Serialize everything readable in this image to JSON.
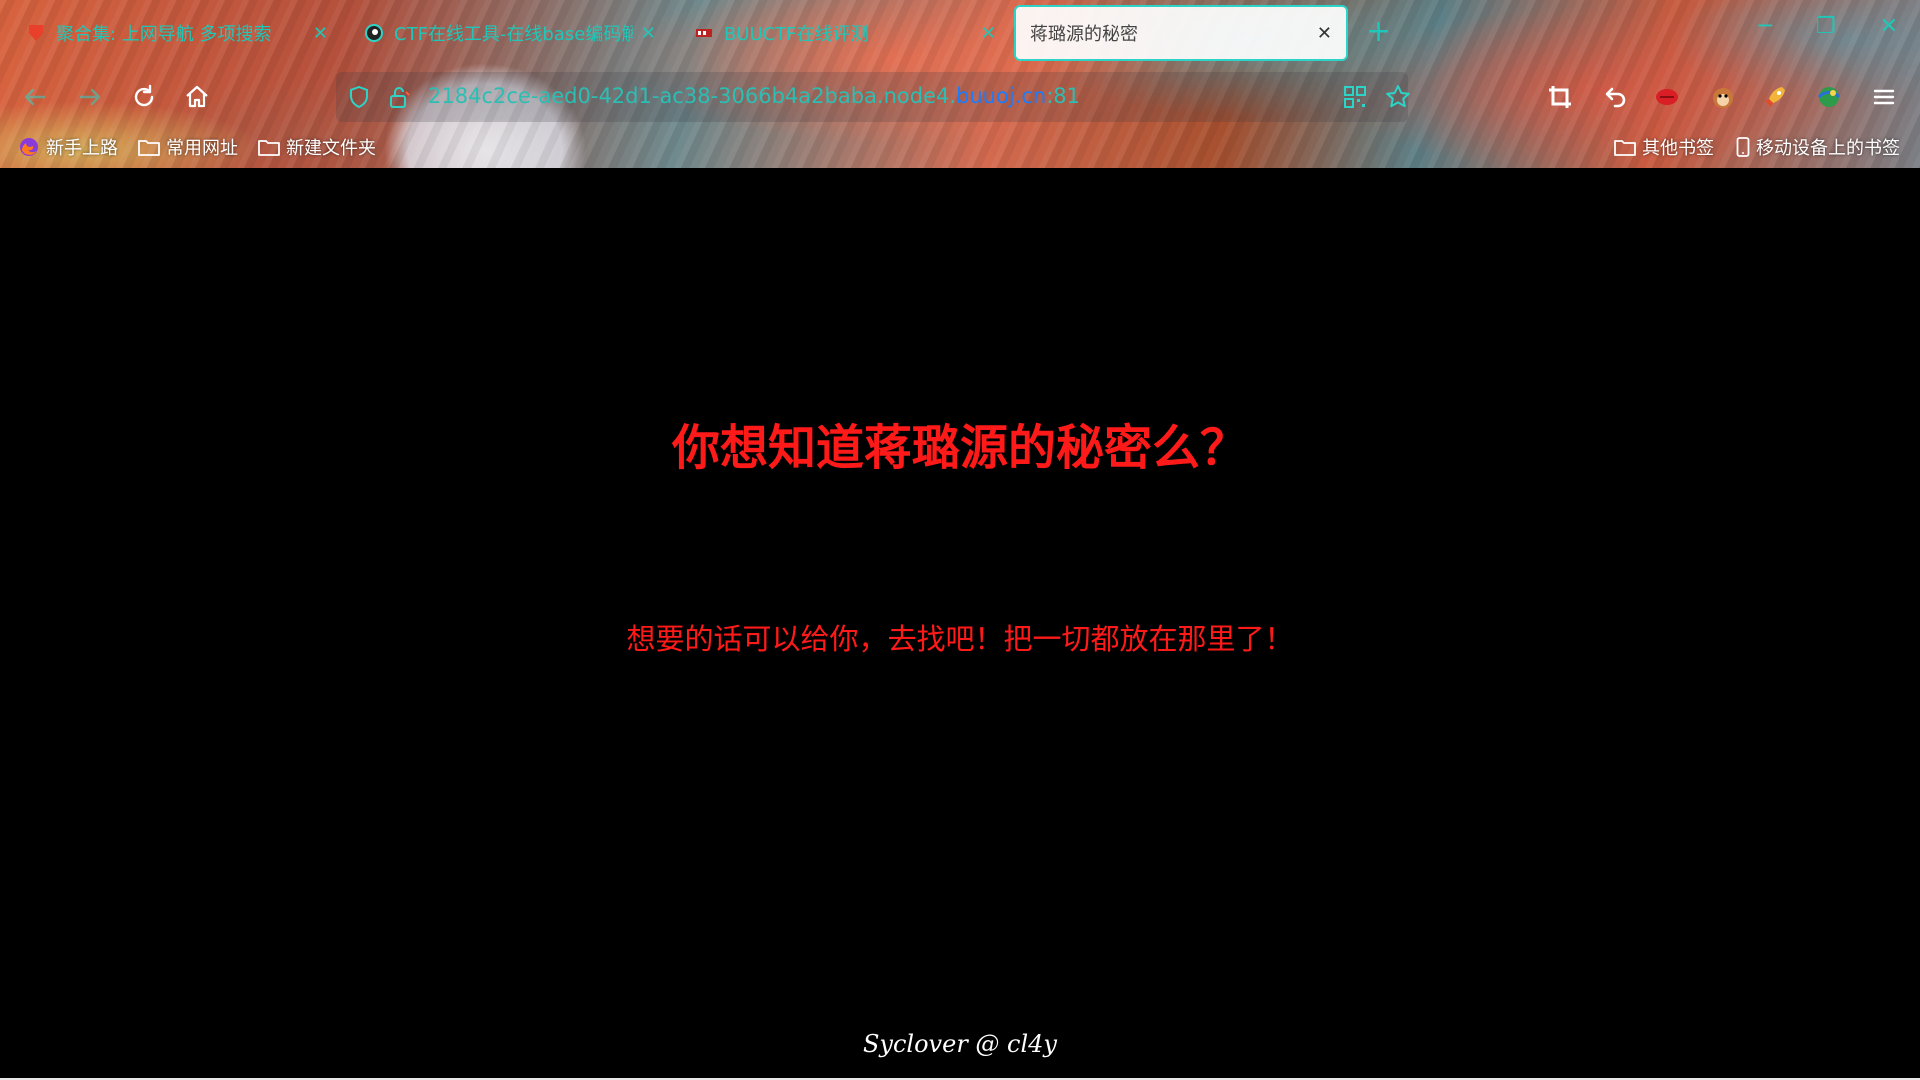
{
  "browser": {
    "tabs": [
      {
        "title": "聚合集: 上网导航 多项搜索",
        "close": "✕",
        "favicon": "red-poly-icon"
      },
      {
        "title": "CTF在线工具-在线base编码解",
        "close": "✕",
        "favicon": "eye-icon"
      },
      {
        "title": "BUUCTF在线评测",
        "close": "✕",
        "favicon": "buuctf-icon"
      },
      {
        "title": "蒋璐源的秘密",
        "close": "✕",
        "active": true
      }
    ],
    "new_tab": "+",
    "window_controls": [
      "─",
      "❐",
      "✕"
    ],
    "url": {
      "prefix": "2184c2ce-aed0-42d1-ac38-3066b4a2baba.node4.",
      "host": "buuoj.cn",
      "port": ":81"
    },
    "bookmarks_left": [
      {
        "label": "新手上路",
        "icon": "firefox-icon"
      },
      {
        "label": "常用网址",
        "icon": "folder-icon"
      },
      {
        "label": "新建文件夹",
        "icon": "folder-icon"
      }
    ],
    "bookmarks_right": [
      {
        "label": "其他书签",
        "icon": "folder-icon"
      },
      {
        "label": "移动设备上的书签",
        "icon": "mobile-icon"
      }
    ],
    "accent_color": "#2bd4c6"
  },
  "page": {
    "heading": "你想知道蒋璐源的秘密么？",
    "subtext": "想要的话可以给你，去找吧！把一切都放在那里了！",
    "footer": "Syclover @ cl4y",
    "text_color": "#ff1a1a",
    "background": "#000000"
  }
}
